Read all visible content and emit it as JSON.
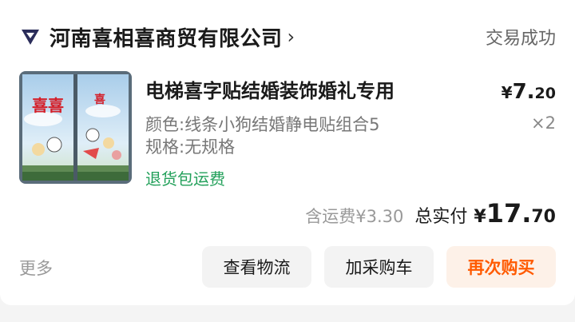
{
  "shop": {
    "name": "河南喜相喜商贸有限公司",
    "arrow": "›",
    "status": "交易成功"
  },
  "item": {
    "title": "电梯喜字贴结婚装饰婚礼专用",
    "price_currency": "¥",
    "price_int": "7.",
    "price_dec": "20",
    "spec_color": "颜色:线条小狗结婚静电贴组合5",
    "spec_size": "规格:无规格",
    "quantity": "×2",
    "return_tag": "退货包运费",
    "thumb_text_left": "喜喜",
    "thumb_text_right": "喜"
  },
  "totals": {
    "shipping": "含运费¥3.30",
    "paid_label": "总实付",
    "paid_currency": "¥",
    "paid_int": "17.",
    "paid_dec": "70"
  },
  "actions": {
    "more": "更多",
    "logistics": "查看物流",
    "add_cart": "加采购车",
    "rebuy": "再次购买"
  },
  "colors": {
    "return_tag": "#22a05a",
    "rebuy_text": "#ff5a00",
    "rebuy_bg": "#fdf1e8",
    "logo": "#2b2d5a"
  },
  "icons": {
    "shop_logo": "diamond-shop-logo-icon",
    "shop_arrow": "chevron-right-icon"
  }
}
